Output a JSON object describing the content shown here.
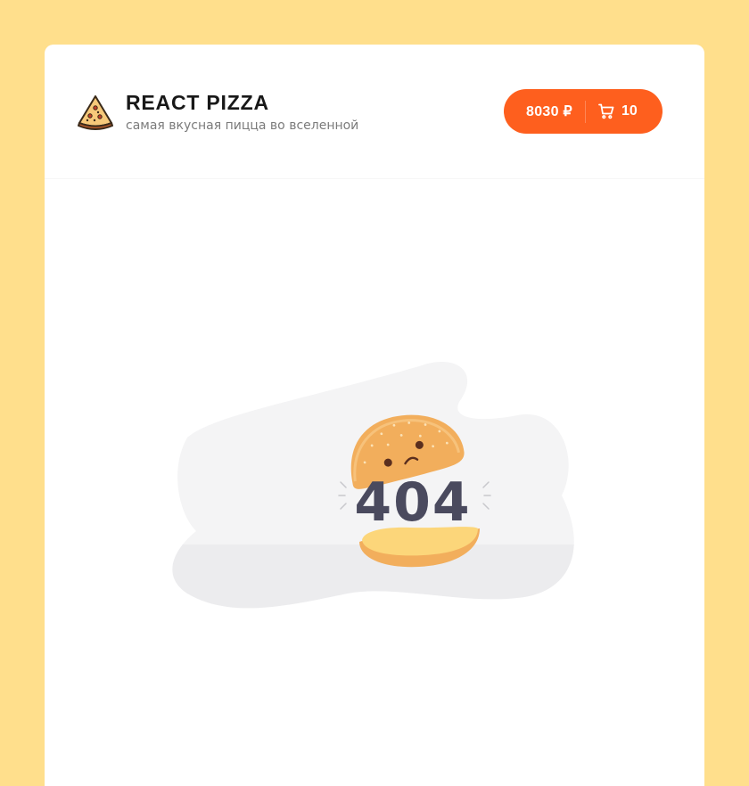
{
  "header": {
    "logo": {
      "icon": "pizza-slice-icon",
      "title": "REACT PIZZA",
      "subtitle": "самая вкусная пицца во вселенной"
    },
    "cart": {
      "price": "8030 ₽",
      "icon": "cart-icon",
      "count": "10"
    }
  },
  "main": {
    "illustration": {
      "icon": "burger-404-icon",
      "text": "404"
    }
  },
  "colors": {
    "page_background": "#FFDF8C",
    "card_background": "#FFFFFF",
    "accent": "#FE5F1E",
    "title": "#181818",
    "subtitle": "#7B7B7B",
    "illustration_text": "#4A4A5E"
  }
}
